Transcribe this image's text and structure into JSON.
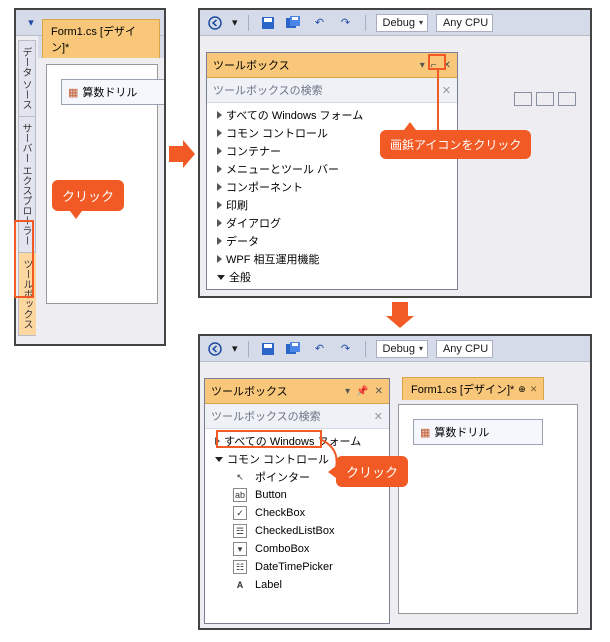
{
  "toolbar": {
    "config_label": "Debug",
    "platform_label": "Any CPU"
  },
  "side_tabs": {
    "t0": "データ ソース",
    "t1": "サーバー エクスプローラー",
    "t2": "ツールボックス"
  },
  "doc_tab": {
    "label": "Form1.cs [デザイン]*"
  },
  "form": {
    "title_icon": "▦",
    "title": "算数ドリル"
  },
  "toolbox": {
    "title": "ツールボックス",
    "search_placeholder": "ツールボックスの検索",
    "dropdown_glyph": "▾",
    "pin_glyph": "⌐",
    "close_glyph": "✕",
    "search_clear": "✕",
    "categories": {
      "c0": "すべての Windows フォーム",
      "c1": "コモン コントロール",
      "c2": "コンテナー",
      "c3": "メニューとツール バー",
      "c4": "コンポーネント",
      "c5": "印刷",
      "c6": "ダイアログ",
      "c7": "データ",
      "c8": "WPF 相互運用機能",
      "c9": "全般"
    },
    "controls": {
      "r0": "ポインター",
      "r1": "Button",
      "r2": "CheckBox",
      "r3": "CheckedListBox",
      "r4": "ComboBox",
      "r5": "DateTimePicker",
      "r6": "Label"
    },
    "control_icons": {
      "i0": "↖",
      "i1": "ab",
      "i2": "✓",
      "i3": "☲",
      "i4": "▾",
      "i5": "☷",
      "i6": "A"
    }
  },
  "callouts": {
    "click": "クリック",
    "pin": "画鋲アイコンをクリック"
  }
}
